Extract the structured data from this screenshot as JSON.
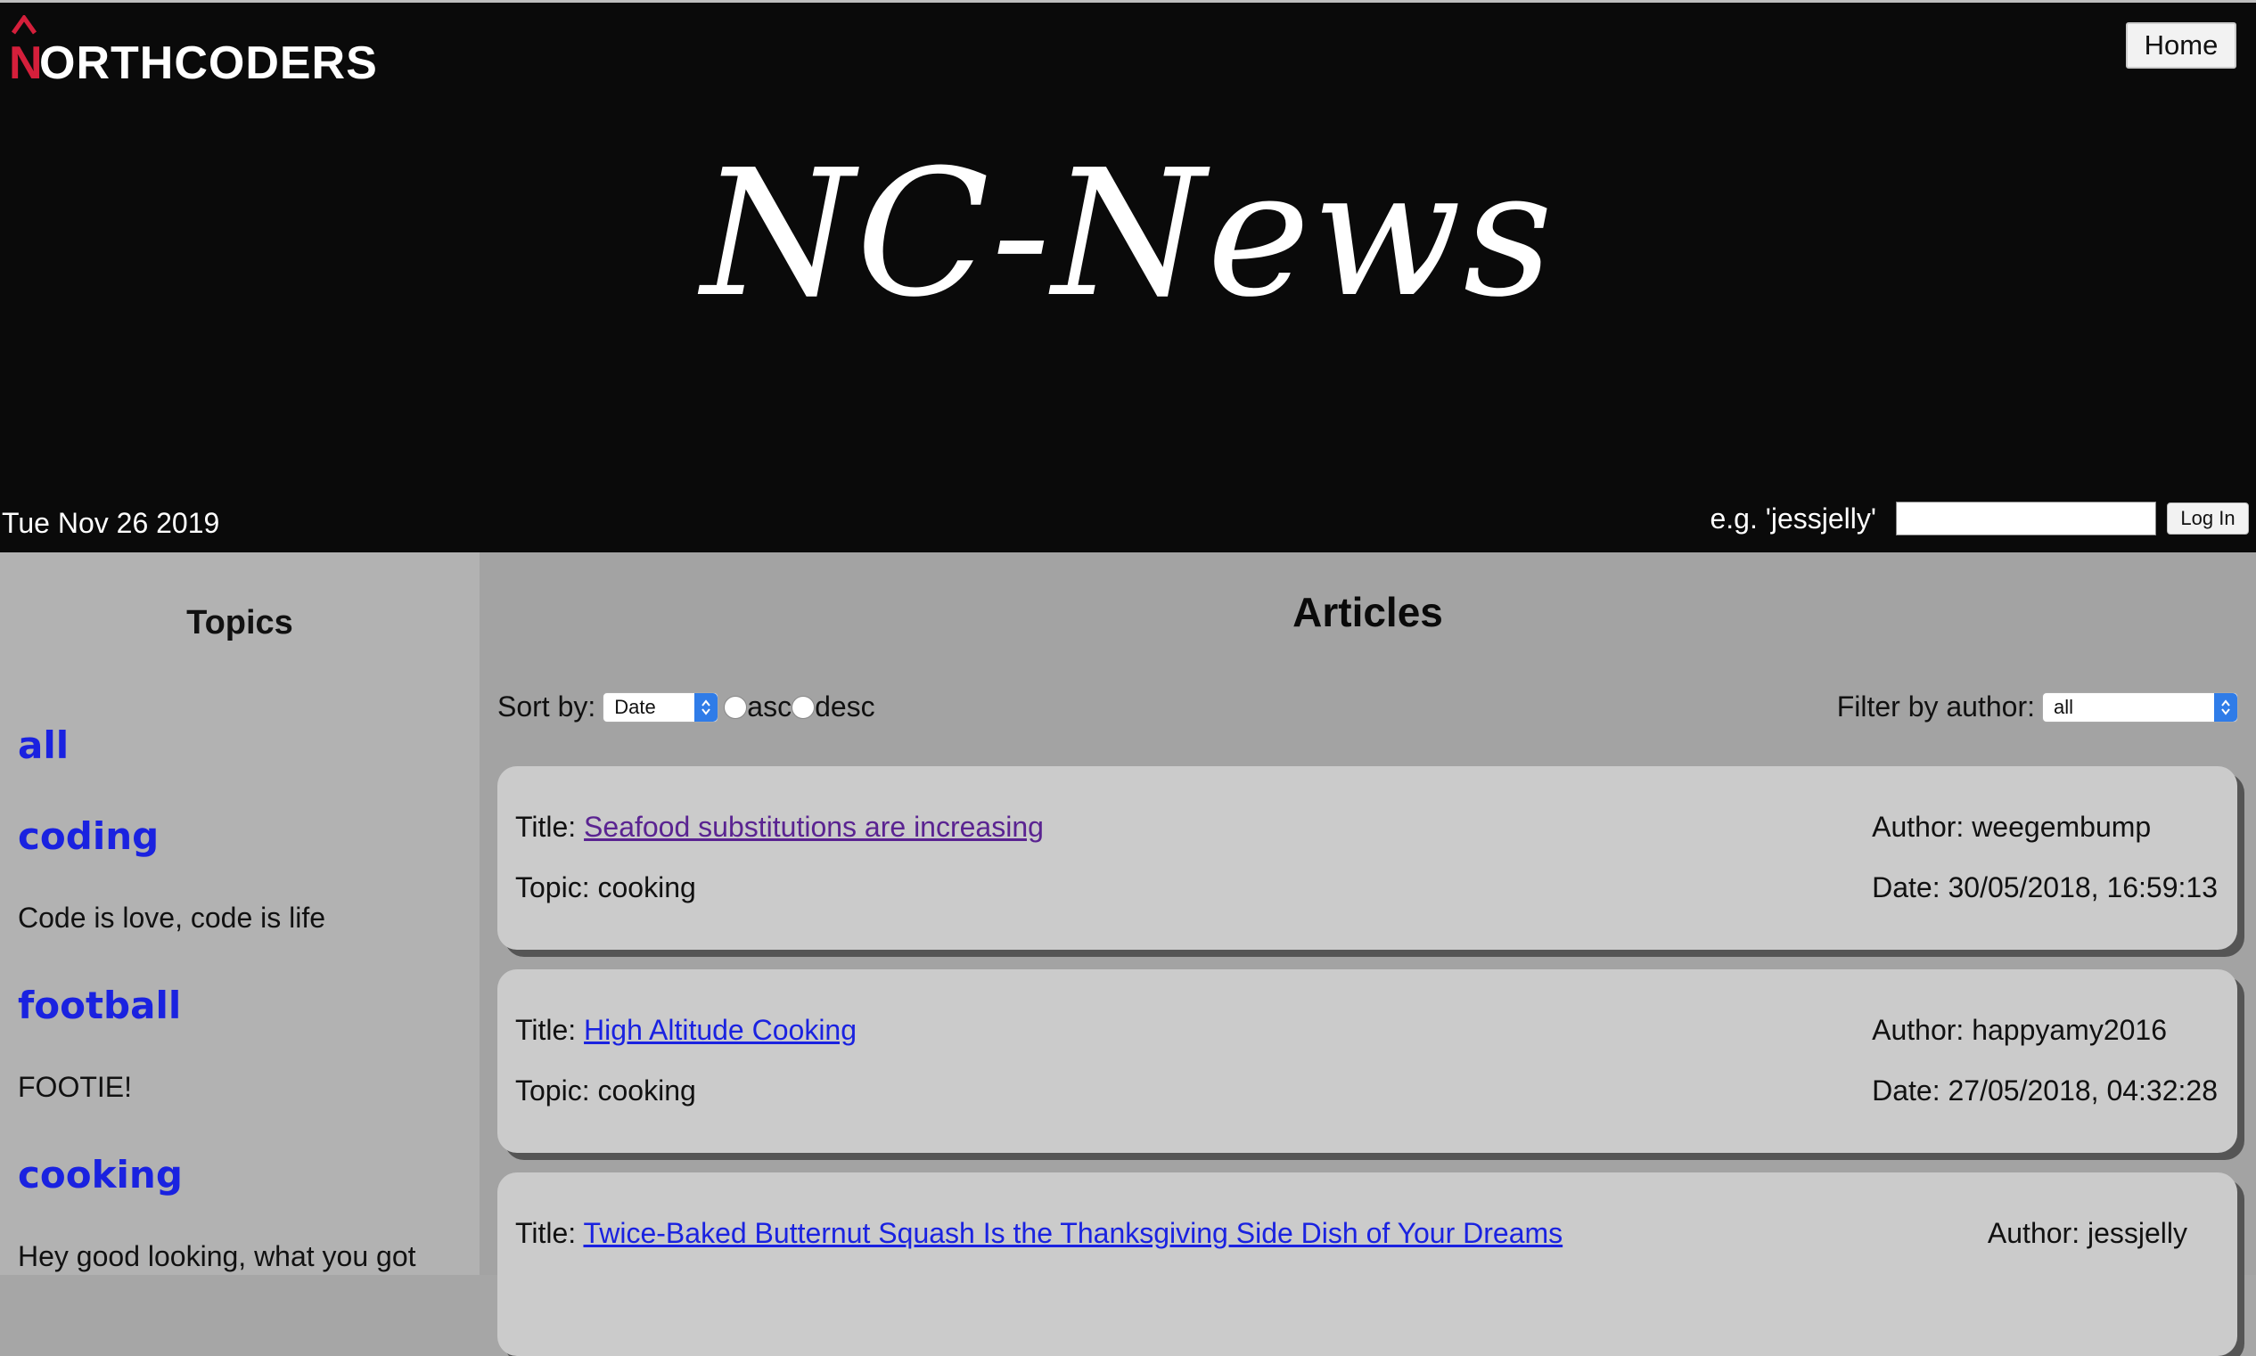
{
  "header": {
    "logo_initial": "N",
    "logo_text": "ORTHCODERS",
    "home_label": "Home",
    "site_title": "NC-News",
    "date": "Tue Nov 26 2019",
    "login_hint": "e.g. 'jessjelly'",
    "login_input_value": "",
    "login_button": "Log In"
  },
  "sidebar": {
    "title": "Topics",
    "topics": [
      {
        "name": "all",
        "description": ""
      },
      {
        "name": "coding",
        "description": "Code is love, code is life"
      },
      {
        "name": "football",
        "description": "FOOTIE!"
      },
      {
        "name": "cooking",
        "description": "Hey good looking, what you got"
      }
    ]
  },
  "main": {
    "title": "Articles",
    "sort_label": "Sort by:",
    "sort_selected": "Date",
    "asc_label": "asc",
    "desc_label": "desc",
    "filter_label": "Filter by author:",
    "filter_selected": "all",
    "title_prefix": "Title: ",
    "topic_prefix": "Topic: ",
    "author_prefix": "Author: ",
    "date_prefix": "Date: ",
    "articles": [
      {
        "title": "Seafood substitutions are increasing",
        "topic": "cooking",
        "author": "weegembump",
        "date": "30/05/2018, 16:59:13",
        "visited": true
      },
      {
        "title": "High Altitude Cooking",
        "topic": "cooking",
        "author": "happyamy2016",
        "date": "27/05/2018, 04:32:28",
        "visited": false
      },
      {
        "title": "Twice-Baked Butternut Squash Is the Thanksgiving Side Dish of Your Dreams",
        "topic": "",
        "author": "jessjelly",
        "date": "",
        "visited": false
      }
    ]
  },
  "colors": {
    "header_bg": "#0a0a0a",
    "logo_accent": "#d51f3b",
    "link": "#1a22e0",
    "visited_link": "#5a2391",
    "sidebar_bg": "#b2b2b2",
    "main_bg": "#a3a3a3",
    "card_bg": "#cbcbcb",
    "select_accent": "#2f7ce8"
  },
  "icons": {
    "logo_mark": "caret-up-icon",
    "select_arrows": "chevron-up-down-icon"
  }
}
